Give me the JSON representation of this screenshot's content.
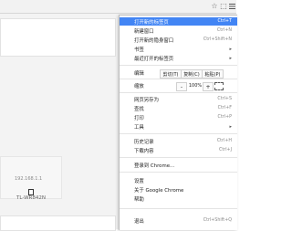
{
  "browser": {
    "star_icon": "☆",
    "ext_icon": "⬚",
    "menu_icon": "hamburger-menu"
  },
  "page": {
    "device_ip": "192.168.1.1",
    "device_model": "TL-WR842N"
  },
  "menu": {
    "highlight_color": "#4285f4",
    "items_top": [
      {
        "label": "打开新的标签页",
        "shortcut": "Ctrl+T"
      },
      {
        "label": "新建窗口",
        "shortcut": "Ctrl+N"
      },
      {
        "label": "打开新的隐身窗口",
        "shortcut": "Ctrl+Shift+N"
      },
      {
        "label": "书签",
        "shortcut": ""
      },
      {
        "label": "最近打开的标签页",
        "shortcut": ""
      }
    ],
    "edit": {
      "label": "编辑",
      "cut": "剪切(T)",
      "copy": "复制(C)",
      "paste": "粘贴(P)"
    },
    "zoom": {
      "label": "缩放",
      "minus": "-",
      "value": "100%",
      "plus": "+"
    },
    "items_mid": [
      {
        "label": "网页另存为",
        "shortcut": "Ctrl+S"
      },
      {
        "label": "查找",
        "shortcut": "Ctrl+F"
      },
      {
        "label": "打印",
        "shortcut": "Ctrl+P"
      },
      {
        "label": "工具",
        "shortcut": ""
      }
    ],
    "items_history": [
      {
        "label": "历史记录",
        "shortcut": "Ctrl+H"
      },
      {
        "label": "下载内容",
        "shortcut": "Ctrl+J"
      }
    ],
    "signin": {
      "label": "登录到 Chrome..."
    },
    "items_bottom": [
      {
        "label": "设置",
        "shortcut": ""
      },
      {
        "label": "关于 Google Chrome",
        "shortcut": ""
      },
      {
        "label": "帮助",
        "shortcut": ""
      }
    ],
    "exit": {
      "label": "退出",
      "shortcut": "Ctrl+Shift+Q"
    }
  }
}
